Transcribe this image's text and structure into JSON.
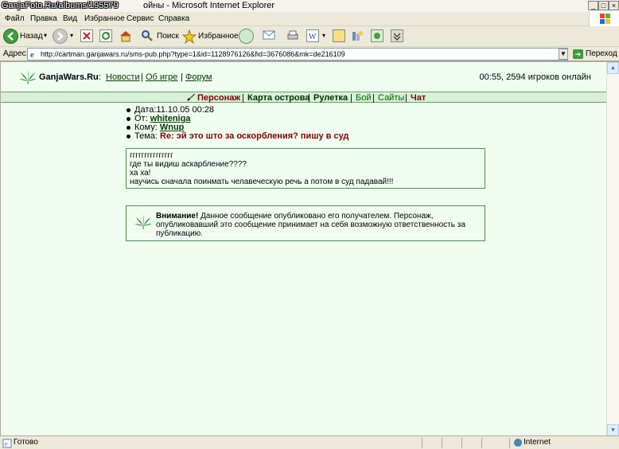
{
  "window": {
    "watermark": "GanjaFoto.Ru/albums/195579",
    "title_tail": "ойны - Microsoft Internet Explorer"
  },
  "menu": {
    "items": [
      "Файл",
      "Правка",
      "Вид",
      "Избранное",
      "Сервис",
      "Справка"
    ]
  },
  "toolbar": {
    "back_label": "Назад",
    "search_label": "Поиск",
    "favorites_label": "Избранное"
  },
  "address": {
    "label": "Адрес:",
    "url": "http://cartman.ganjawars.ru/sms-pub.php?type=1&id=1128976126&fid=3676086&mk=de216109",
    "go_label": "Переход"
  },
  "site": {
    "name": "GanjaWars.Ru",
    "colon": ":",
    "links": [
      "Новости",
      "Об игре",
      "Форум"
    ],
    "online": "00:55, 2594 игроков онлайн"
  },
  "nav": {
    "items": [
      "Персонаж",
      "Карта острова",
      "Рулетка",
      "Бой",
      "Сайты",
      "Чат"
    ]
  },
  "message": {
    "date_label": "Дата:",
    "date_value": "11.10.05 00:28",
    "from_label": "От:",
    "from_value": "whiteniga",
    "to_label": "Кому:",
    "to_value": "Wnup",
    "subject_label": "Тема:",
    "subject_value": "Re: эй это што за оскорбления? пишу в суд",
    "body": [
      "ггггггггггггггг",
      "где ты видиш аскарбление????",
      "ха ха!",
      "научись сначала поинмать челавеческую речь а потом в суд падавай!!!"
    ]
  },
  "notice": {
    "title": "Внимание!",
    "text": "Данное сообщение опубликовано его получателем. Персонаж, опубликовавший это сообщение принимает на себя возможную ответственность за публикацию."
  },
  "status": {
    "text": "Готово",
    "zone": "Internet"
  },
  "colors": {
    "page_bg": "#f0fcf0",
    "nav_bg": "#d8f0d8",
    "active_nav": "#800000",
    "link": "#004000",
    "border": "#509050"
  }
}
